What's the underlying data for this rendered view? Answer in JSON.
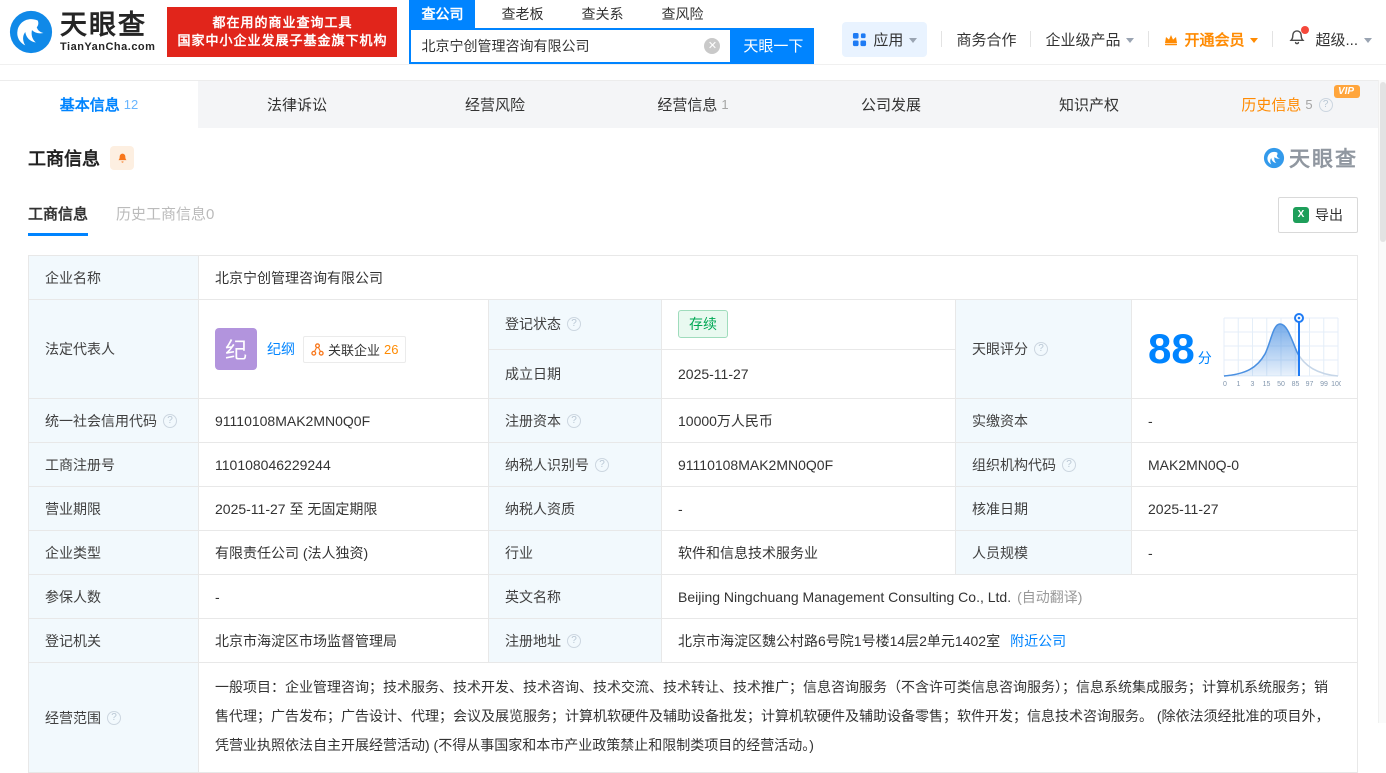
{
  "brand": {
    "name": "天眼查",
    "domain": "TianYanCha.com",
    "slogan_line1": "都在用的商业查询工具",
    "slogan_line2": "国家中小企业发展子基金旗下机构",
    "accent_color": "#0084ff",
    "slogan_bg_color": "#e1251b"
  },
  "search": {
    "tabs": [
      {
        "label": "查公司",
        "active": true
      },
      {
        "label": "查老板",
        "active": false
      },
      {
        "label": "查关系",
        "active": false
      },
      {
        "label": "查风险",
        "active": false
      }
    ],
    "value": "北京宁创管理咨询有限公司",
    "button_label": "天眼一下"
  },
  "topnav": {
    "apps": "应用",
    "business": "商务合作",
    "enterprise": "企业级产品",
    "vip": "开通会员",
    "super": "超级..."
  },
  "page_tabs": [
    {
      "label": "基本信息",
      "count": "12",
      "active": true
    },
    {
      "label": "法律诉讼",
      "count": ""
    },
    {
      "label": "经营风险",
      "count": ""
    },
    {
      "label": "经营信息",
      "count": "1"
    },
    {
      "label": "公司发展",
      "count": ""
    },
    {
      "label": "知识产权",
      "count": ""
    },
    {
      "label": "历史信息",
      "count": "5",
      "vip_badge": "VIP"
    }
  ],
  "section": {
    "title": "工商信息",
    "subtab_active": "工商信息",
    "subtab_history": "历史工商信息0",
    "export_label": "导出",
    "watermark": "天眼查"
  },
  "score": {
    "label": "天眼评分",
    "value": "88",
    "unit": "分",
    "axis_labels": [
      "0",
      "1",
      "3",
      "15",
      "50",
      "85",
      "97",
      "99",
      "100"
    ],
    "marker_value": 88
  },
  "fields": {
    "company_name": {
      "label": "企业名称",
      "value": "北京宁创管理咨询有限公司"
    },
    "legal_rep": {
      "label": "法定代表人",
      "avatar_char": "纪",
      "name": "纪纲",
      "related_label": "关联企业",
      "related_count": "26"
    },
    "reg_status": {
      "label": "登记状态",
      "value": "存续"
    },
    "establish_date": {
      "label": "成立日期",
      "value": "2025-11-27"
    },
    "credit_code": {
      "label": "统一社会信用代码",
      "value": "91110108MAK2MN0Q0F"
    },
    "reg_capital": {
      "label": "注册资本",
      "value": "10000万人民币"
    },
    "paid_capital": {
      "label": "实缴资本",
      "value": "-"
    },
    "reg_number": {
      "label": "工商注册号",
      "value": "110108046229244"
    },
    "taxpayer_id": {
      "label": "纳税人识别号",
      "value": "91110108MAK2MN0Q0F"
    },
    "org_code": {
      "label": "组织机构代码",
      "value": "MAK2MN0Q-0"
    },
    "business_term": {
      "label": "营业期限",
      "value": "2025-11-27 至 无固定期限"
    },
    "taxpayer_quality": {
      "label": "纳税人资质",
      "value": "-"
    },
    "approve_date": {
      "label": "核准日期",
      "value": "2025-11-27"
    },
    "company_type": {
      "label": "企业类型",
      "value": "有限责任公司 (法人独资)"
    },
    "industry": {
      "label": "行业",
      "value": "软件和信息技术服务业"
    },
    "staff_size": {
      "label": "人员规模",
      "value": "-"
    },
    "insured_count": {
      "label": "参保人数",
      "value": "-"
    },
    "english_name": {
      "label": "英文名称",
      "value": "Beijing Ningchuang Management Consulting Co., Ltd.",
      "note": "(自动翻译)"
    },
    "reg_authority": {
      "label": "登记机关",
      "value": "北京市海淀区市场监督管理局"
    },
    "reg_address": {
      "label": "注册地址",
      "value": "北京市海淀区魏公村路6号院1号楼14层2单元1402室",
      "link": "附近公司"
    },
    "business_scope": {
      "label": "经营范围",
      "value": "一般项目：企业管理咨询；技术服务、技术开发、技术咨询、技术交流、技术转让、技术推广；信息咨询服务（不含许可类信息咨询服务）；信息系统集成服务；计算机系统服务；销售代理；广告发布；广告设计、代理；会议及展览服务；计算机软硬件及辅助设备批发；计算机软硬件及辅助设备零售；软件开发；信息技术咨询服务。 (除依法须经批准的项目外，凭营业执照依法自主开展经营活动)  (不得从事国家和本市产业政策禁止和限制类项目的经营活动。)"
    }
  }
}
